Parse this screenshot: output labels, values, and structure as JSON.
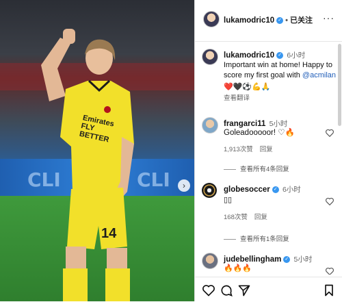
{
  "post": {
    "author": "lukamodric10",
    "follow_status": "已关注",
    "caption": {
      "username": "lukamodric10",
      "time": "6小时",
      "text_before_mention": "Important win at home! Happy to score my first goal with ",
      "mention": "@acmilan",
      "emojis": "❤️🖤⚽💪🙏",
      "translate_label": "查看翻译"
    },
    "photo": {
      "shirt_sponsor": "Emirates FLY BETTER",
      "shirt_number": "14",
      "banner_text": "CLI"
    }
  },
  "comments": [
    {
      "username": "frangarci11",
      "time": "5小时",
      "text": "Goleadooooor! ",
      "emojis": "♡🔥",
      "likes": "1,913次赞",
      "reply_label": "回复",
      "view_replies": "查看所有4条回复"
    },
    {
      "username": "globesoccer",
      "time": "6小时",
      "text": "▯▯",
      "likes": "168次赞",
      "reply_label": "回复",
      "view_replies": "查看所有1条回复"
    },
    {
      "username": "judebellingham",
      "time": "5小时",
      "text": "",
      "emojis": "🔥🔥🔥"
    }
  ],
  "icons": [
    "heart-icon",
    "comment-icon",
    "share-icon",
    "bookmark-icon",
    "more-icon",
    "chevron-right-icon",
    "verified-icon"
  ],
  "colors": {
    "verified": "#3897f0",
    "mention": "#1f5db8",
    "shirt": "#f2e02a"
  }
}
